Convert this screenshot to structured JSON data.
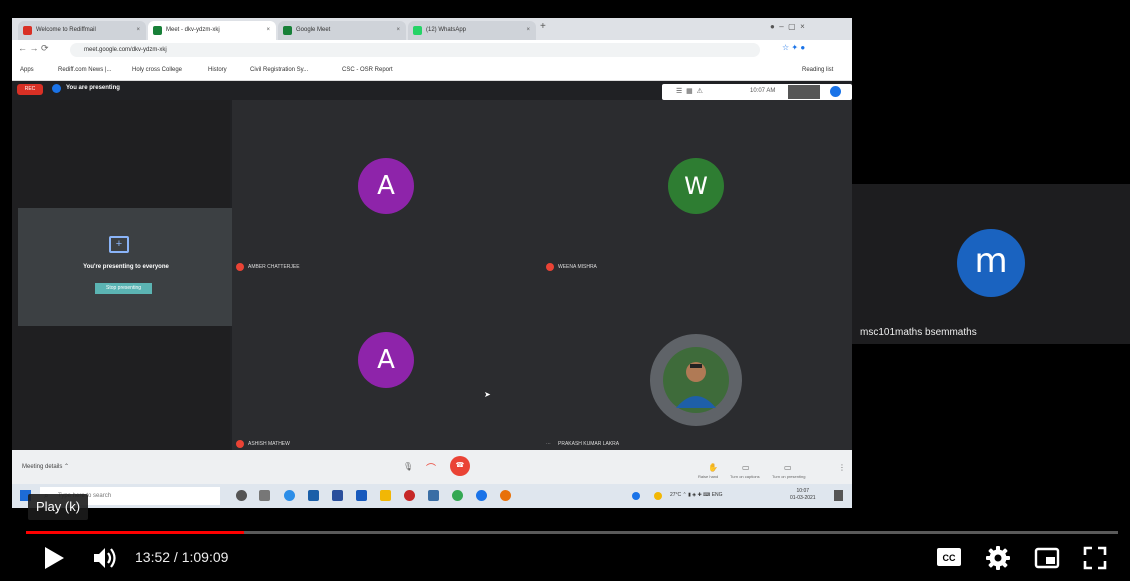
{
  "recording": {
    "tabs": [
      {
        "label": "Welcome to Rediffmail",
        "color": "#d93025"
      },
      {
        "label": "Meet - dkv-ydzm-xkj",
        "color": "#188038"
      },
      {
        "label": "Google Meet",
        "color": "#188038"
      },
      {
        "label": "(12) WhatsApp",
        "color": "#25d366"
      }
    ],
    "url": "meet.google.com/dkv-ydzm-xkj",
    "bookmarks": [
      "Apps",
      "Rediff.com News |...",
      "Holy cross College",
      "History",
      "Civil Registration Sy...",
      "CSC - OSR Report"
    ],
    "reading_list": "Reading list",
    "rec_label": "REC",
    "presenting_label": "You are presenting",
    "time_in_meet": "10:07 AM",
    "presenting_to_everyone": "You're presenting to everyone",
    "stop_presenting": "Stop presenting",
    "participants": [
      {
        "initial": "A",
        "color": "#8e24aa",
        "name": "AMBER CHATTERJEE"
      },
      {
        "initial": "W",
        "color": "#2e7d32",
        "name": "WEENA MISHRA"
      },
      {
        "initial": "A",
        "color": "#8e24aa",
        "name": "ASHISH MATHEW"
      },
      {
        "initial": "",
        "color": "#455a64",
        "name": "PRAKASH KUMAR LAKRA"
      }
    ],
    "meeting_details": "Meeting details",
    "control_labels": [
      "Raise hand",
      "Turn on captions",
      "Turn on presenting"
    ],
    "taskbar_search": "Type here to search",
    "tray_text": "27°C",
    "clock_time": "10:07",
    "clock_date": "01-03-2021"
  },
  "side_panel": {
    "initial": "m",
    "name": "msc101maths bsemmaths",
    "avatar_color": "#1a63c0"
  },
  "player": {
    "tooltip": "Play (k)",
    "current_time": "13:52",
    "duration": "1:09:09",
    "progress_fraction": 0.2,
    "progress_color": "#ff0000"
  }
}
